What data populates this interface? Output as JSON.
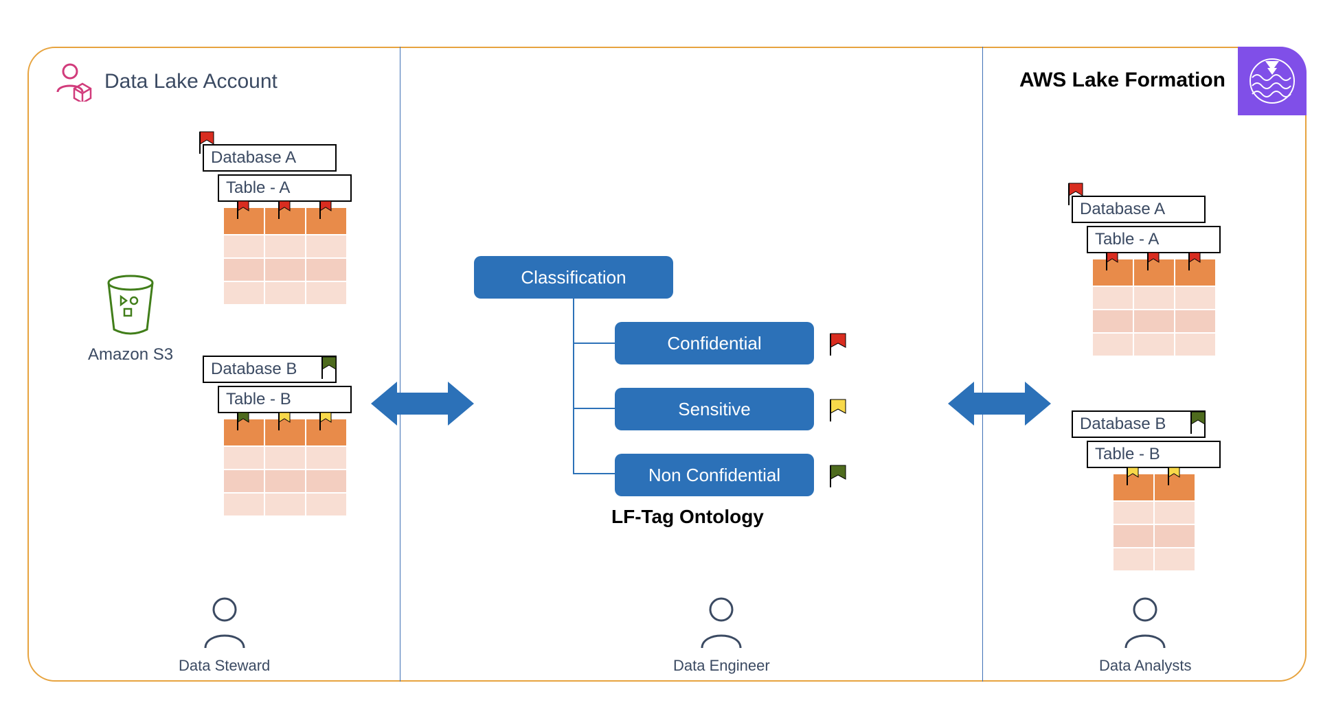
{
  "account_label": "Data Lake Account",
  "service_label": "AWS Lake Formation",
  "s3_label": "Amazon S3",
  "db_a": {
    "name": "Database A",
    "table": "Table - A"
  },
  "db_b": {
    "name": "Database B",
    "table": "Table - B"
  },
  "ontology": {
    "root": "Classification",
    "children": [
      {
        "label": "Confidential",
        "flag": "red"
      },
      {
        "label": "Sensitive",
        "flag": "yellow"
      },
      {
        "label": "Non Confidential",
        "flag": "green"
      }
    ],
    "caption": "LF-Tag Ontology"
  },
  "roles": {
    "steward": "Data Steward",
    "engineer": "Data Engineer",
    "analysts": "Data Analysts"
  },
  "left_panel": {
    "db_a_flags": [
      "red",
      "red",
      "red"
    ],
    "db_b_flags": [
      "green",
      "yellow",
      "yellow"
    ]
  },
  "right_panel": {
    "db_a_flags": [
      "red",
      "red",
      "red"
    ],
    "db_b_flags": [
      "yellow",
      "yellow"
    ]
  },
  "colors": {
    "confidential": "#D92D20",
    "sensitive": "#F8D94A",
    "non_confidential": "#4E6B1E",
    "node": "#2C71B8",
    "border": "#E7A33E",
    "lake_formation": "#804FE8"
  }
}
